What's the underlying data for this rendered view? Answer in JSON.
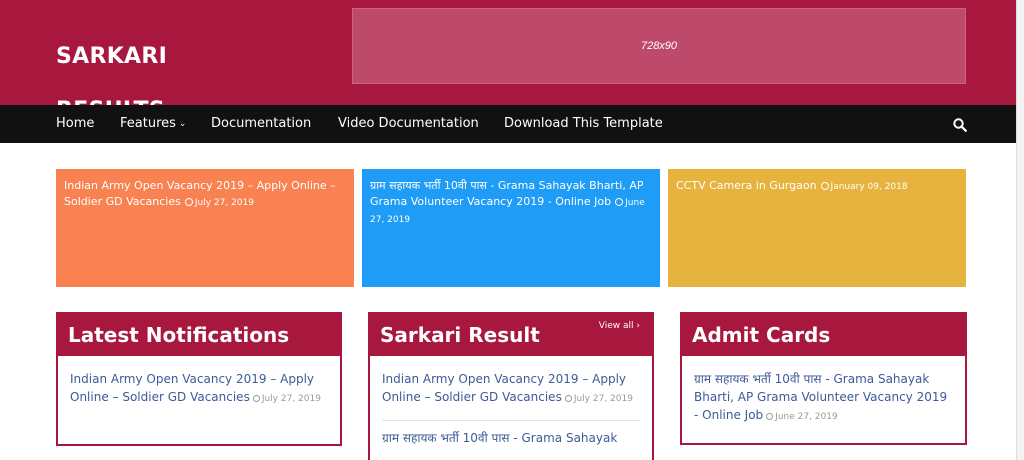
{
  "header": {
    "logo": "SARKARI RESULTS",
    "ad_label": "728x90",
    "bg_color": "#a8173e"
  },
  "nav": {
    "items": [
      {
        "label": "Home"
      },
      {
        "label": "Features",
        "has_dropdown": true
      },
      {
        "label": "Documentation"
      },
      {
        "label": "Video Documentation"
      },
      {
        "label": "Download This Template"
      }
    ],
    "search_icon": "search-icon"
  },
  "featured": [
    {
      "title": "Indian Army Open Vacancy 2019 – Apply Online – Soldier GD Vacancies",
      "date": "July 27, 2019",
      "color": "#f98252"
    },
    {
      "title": "ग्राम सहायक भर्ती 10वी पास - Grama Sahayak Bharti, AP Grama Volunteer Vacancy 2019 - Online Job",
      "date": "June 27, 2019",
      "color": "#1e9cf6"
    },
    {
      "title": "CCTV Camera in Gurgaon",
      "date": "January 09, 2018",
      "color": "#e6b33e"
    }
  ],
  "widgets": [
    {
      "title": "Latest Notifications",
      "posts": [
        {
          "title": "Indian Army Open Vacancy 2019 – Apply Online – Soldier GD Vacancies",
          "date": "July 27, 2019"
        }
      ]
    },
    {
      "title": "Sarkari Result",
      "view_all": "View all",
      "posts": [
        {
          "title": "Indian Army Open Vacancy 2019 – Apply Online – Soldier GD Vacancies",
          "date": "July 27, 2019"
        },
        {
          "title": "ग्राम सहायक भर्ती 10वी पास - Grama Sahayak",
          "date": ""
        }
      ]
    },
    {
      "title": "Admit Cards",
      "posts": [
        {
          "title": "ग्राम सहायक भर्ती 10वी पास - Grama Sahayak Bharti, AP Grama Volunteer Vacancy 2019 - Online Job",
          "date": "June 27, 2019"
        }
      ]
    }
  ]
}
